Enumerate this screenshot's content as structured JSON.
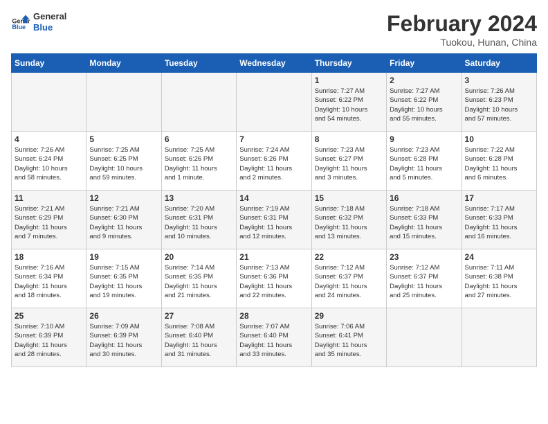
{
  "logo": {
    "line1": "General",
    "line2": "Blue"
  },
  "title": "February 2024",
  "subtitle": "Tuokou, Hunan, China",
  "weekdays": [
    "Sunday",
    "Monday",
    "Tuesday",
    "Wednesday",
    "Thursday",
    "Friday",
    "Saturday"
  ],
  "weeks": [
    [
      {
        "day": "",
        "info": ""
      },
      {
        "day": "",
        "info": ""
      },
      {
        "day": "",
        "info": ""
      },
      {
        "day": "",
        "info": ""
      },
      {
        "day": "1",
        "info": "Sunrise: 7:27 AM\nSunset: 6:22 PM\nDaylight: 10 hours\nand 54 minutes."
      },
      {
        "day": "2",
        "info": "Sunrise: 7:27 AM\nSunset: 6:22 PM\nDaylight: 10 hours\nand 55 minutes."
      },
      {
        "day": "3",
        "info": "Sunrise: 7:26 AM\nSunset: 6:23 PM\nDaylight: 10 hours\nand 57 minutes."
      }
    ],
    [
      {
        "day": "4",
        "info": "Sunrise: 7:26 AM\nSunset: 6:24 PM\nDaylight: 10 hours\nand 58 minutes."
      },
      {
        "day": "5",
        "info": "Sunrise: 7:25 AM\nSunset: 6:25 PM\nDaylight: 10 hours\nand 59 minutes."
      },
      {
        "day": "6",
        "info": "Sunrise: 7:25 AM\nSunset: 6:26 PM\nDaylight: 11 hours\nand 1 minute."
      },
      {
        "day": "7",
        "info": "Sunrise: 7:24 AM\nSunset: 6:26 PM\nDaylight: 11 hours\nand 2 minutes."
      },
      {
        "day": "8",
        "info": "Sunrise: 7:23 AM\nSunset: 6:27 PM\nDaylight: 11 hours\nand 3 minutes."
      },
      {
        "day": "9",
        "info": "Sunrise: 7:23 AM\nSunset: 6:28 PM\nDaylight: 11 hours\nand 5 minutes."
      },
      {
        "day": "10",
        "info": "Sunrise: 7:22 AM\nSunset: 6:28 PM\nDaylight: 11 hours\nand 6 minutes."
      }
    ],
    [
      {
        "day": "11",
        "info": "Sunrise: 7:21 AM\nSunset: 6:29 PM\nDaylight: 11 hours\nand 7 minutes."
      },
      {
        "day": "12",
        "info": "Sunrise: 7:21 AM\nSunset: 6:30 PM\nDaylight: 11 hours\nand 9 minutes."
      },
      {
        "day": "13",
        "info": "Sunrise: 7:20 AM\nSunset: 6:31 PM\nDaylight: 11 hours\nand 10 minutes."
      },
      {
        "day": "14",
        "info": "Sunrise: 7:19 AM\nSunset: 6:31 PM\nDaylight: 11 hours\nand 12 minutes."
      },
      {
        "day": "15",
        "info": "Sunrise: 7:18 AM\nSunset: 6:32 PM\nDaylight: 11 hours\nand 13 minutes."
      },
      {
        "day": "16",
        "info": "Sunrise: 7:18 AM\nSunset: 6:33 PM\nDaylight: 11 hours\nand 15 minutes."
      },
      {
        "day": "17",
        "info": "Sunrise: 7:17 AM\nSunset: 6:33 PM\nDaylight: 11 hours\nand 16 minutes."
      }
    ],
    [
      {
        "day": "18",
        "info": "Sunrise: 7:16 AM\nSunset: 6:34 PM\nDaylight: 11 hours\nand 18 minutes."
      },
      {
        "day": "19",
        "info": "Sunrise: 7:15 AM\nSunset: 6:35 PM\nDaylight: 11 hours\nand 19 minutes."
      },
      {
        "day": "20",
        "info": "Sunrise: 7:14 AM\nSunset: 6:35 PM\nDaylight: 11 hours\nand 21 minutes."
      },
      {
        "day": "21",
        "info": "Sunrise: 7:13 AM\nSunset: 6:36 PM\nDaylight: 11 hours\nand 22 minutes."
      },
      {
        "day": "22",
        "info": "Sunrise: 7:12 AM\nSunset: 6:37 PM\nDaylight: 11 hours\nand 24 minutes."
      },
      {
        "day": "23",
        "info": "Sunrise: 7:12 AM\nSunset: 6:37 PM\nDaylight: 11 hours\nand 25 minutes."
      },
      {
        "day": "24",
        "info": "Sunrise: 7:11 AM\nSunset: 6:38 PM\nDaylight: 11 hours\nand 27 minutes."
      }
    ],
    [
      {
        "day": "25",
        "info": "Sunrise: 7:10 AM\nSunset: 6:39 PM\nDaylight: 11 hours\nand 28 minutes."
      },
      {
        "day": "26",
        "info": "Sunrise: 7:09 AM\nSunset: 6:39 PM\nDaylight: 11 hours\nand 30 minutes."
      },
      {
        "day": "27",
        "info": "Sunrise: 7:08 AM\nSunset: 6:40 PM\nDaylight: 11 hours\nand 31 minutes."
      },
      {
        "day": "28",
        "info": "Sunrise: 7:07 AM\nSunset: 6:40 PM\nDaylight: 11 hours\nand 33 minutes."
      },
      {
        "day": "29",
        "info": "Sunrise: 7:06 AM\nSunset: 6:41 PM\nDaylight: 11 hours\nand 35 minutes."
      },
      {
        "day": "",
        "info": ""
      },
      {
        "day": "",
        "info": ""
      }
    ]
  ]
}
